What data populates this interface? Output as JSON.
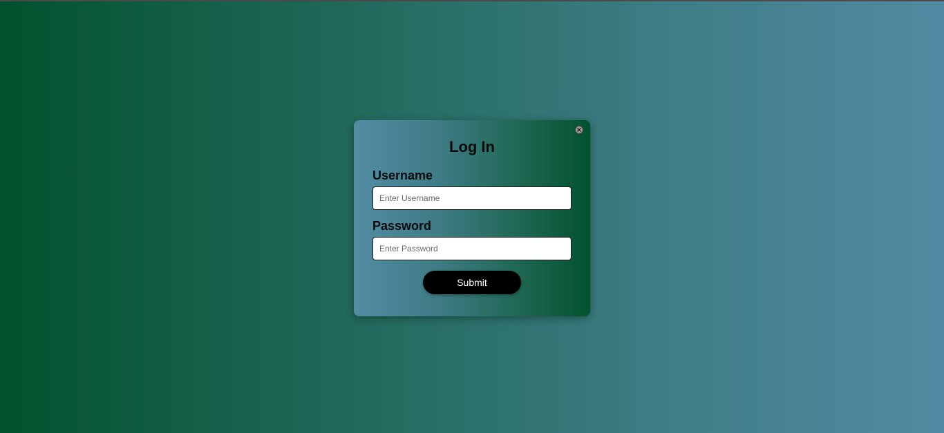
{
  "colors": {
    "background_gradient": [
      "#02522e",
      "#528aa3"
    ],
    "modal_gradient": [
      "#538ca4",
      "#02522e"
    ],
    "submit_bg": "#000000",
    "submit_text": "#ffffff"
  },
  "modal": {
    "title": "Log In",
    "close_icon": "close-icon",
    "username": {
      "label": "Username",
      "placeholder": "Enter Username",
      "value": ""
    },
    "password": {
      "label": "Password",
      "placeholder": "Enter Password",
      "value": ""
    },
    "submit_label": "Submit"
  }
}
